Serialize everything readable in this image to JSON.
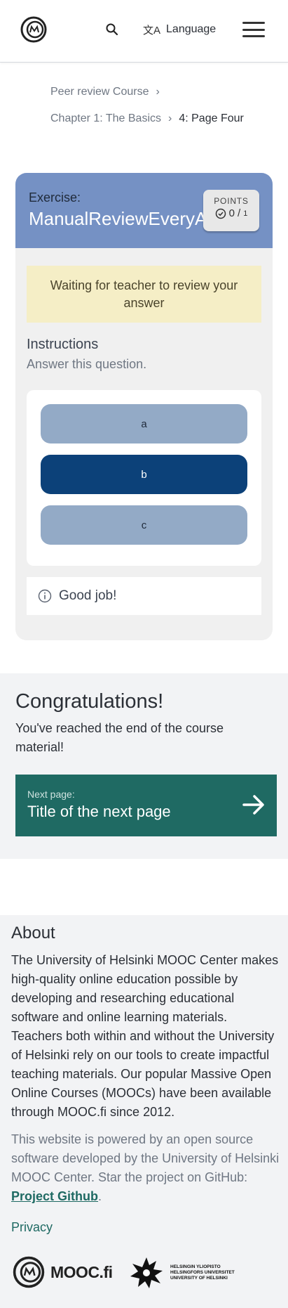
{
  "header": {
    "logo_alt": "MOOC.fi logo",
    "search_icon": "search-icon",
    "language_label": "Language",
    "language_icon": "translate-icon",
    "menu_icon": "hamburger-menu-icon"
  },
  "breadcrumb": {
    "course": "Peer review Course",
    "chapter": "Chapter 1: The Basics",
    "page": "4: Page Four",
    "separator": "›"
  },
  "exercise": {
    "kicker": "Exercise:",
    "title": "ManualReviewEveryAnswer",
    "points_label": "POINTS",
    "points_earned": "0",
    "points_max": "1",
    "status_message": "Waiting for teacher to review your answer",
    "instructions_title": "Instructions",
    "instructions_text": "Answer this question.",
    "options": [
      {
        "label": "a",
        "selected": false
      },
      {
        "label": "b",
        "selected": true
      },
      {
        "label": "c",
        "selected": false
      }
    ],
    "feedback": "Good job!"
  },
  "congrats": {
    "title": "Congratulations!",
    "text": "You've reached the end of the course material!",
    "next_kicker": "Next page:",
    "next_title": "Title of the next page"
  },
  "about": {
    "title": "About",
    "paragraph1": "The University of Helsinki MOOC Center makes high-quality online education possible by developing and researching educational software and online learning materials. Teachers both within and without the University of Helsinki rely on our tools to create impactful teaching materials. Our popular Massive Open Online Courses (MOOCs) have been available through MOOC.fi since 2012.",
    "paragraph2_prefix": "This website is powered by an open source software developed by the University of Helsinki MOOC Center. Star the project on GitHub: ",
    "github_link": "Project Github",
    "paragraph2_suffix": ".",
    "privacy": "Privacy",
    "mooc_wordmark": "MOOC.fi",
    "hy_lines": [
      "HELSINGIN YLIOPISTO",
      "HELSINGFORS UNIVERSITET",
      "UNIVERSITY OF HELSINKI"
    ]
  },
  "colors": {
    "exercise_header": "#7591c4",
    "option_default": "#93aac6",
    "option_selected": "#0c4179",
    "status_bg": "#f5eec6",
    "next_button": "#1f6a63",
    "link": "#1f6a63"
  }
}
